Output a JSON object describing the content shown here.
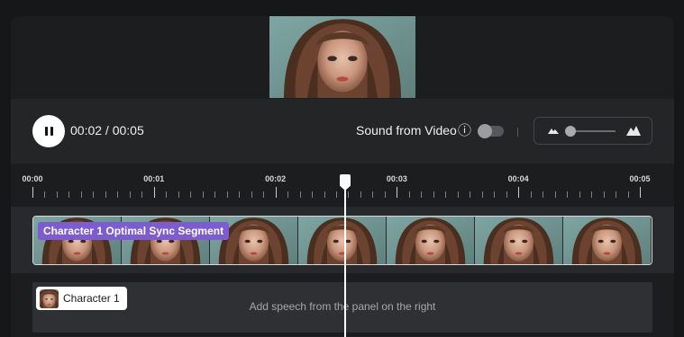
{
  "player": {
    "current_time": "00:02",
    "separator": " / ",
    "total_time": "00:05",
    "sound_label": "Sound from Video",
    "info_icon": "ⓘ",
    "sound_enabled": false,
    "volume_level": 0.15
  },
  "ruler": {
    "labels": [
      "00:00",
      "00:01",
      "00:02",
      "00:03",
      "00:04",
      "00:05"
    ]
  },
  "video_track": {
    "segment_label": "Character 1 Optimal Sync Segment"
  },
  "audio_track": {
    "character_name": "Character 1",
    "placeholder": "Add speech from the panel on the right"
  },
  "icons": {
    "play_pause": "pause-icon",
    "volume_low": "mountain-small-icon",
    "volume_high": "mountain-large-icon",
    "info": "info-icon"
  },
  "colors": {
    "accent_purple": "#7c5ccf",
    "playhead": "#ffffff"
  }
}
